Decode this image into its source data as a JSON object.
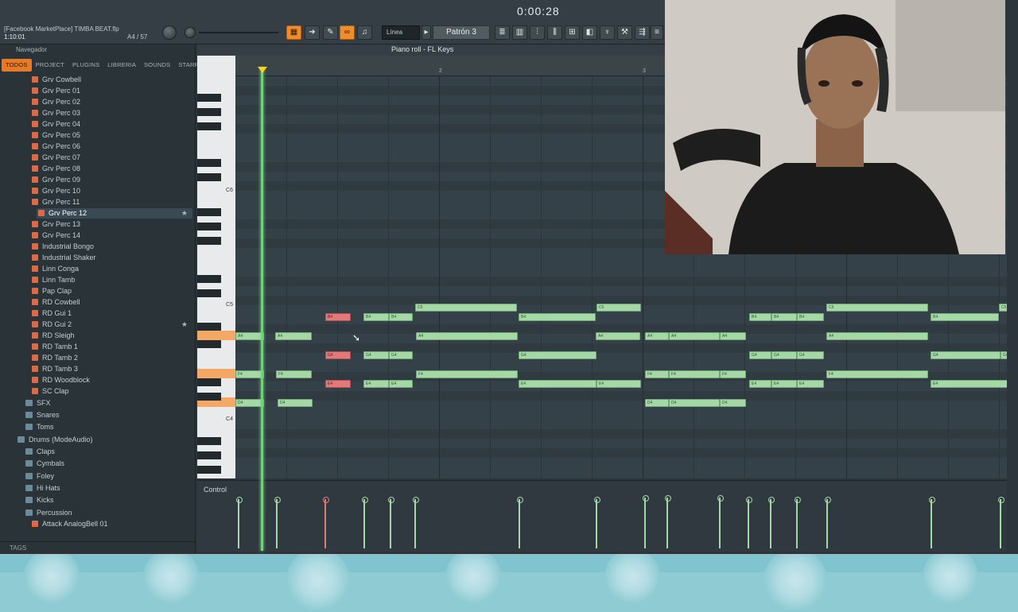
{
  "toolbar": {
    "project_title": "[Facebook MarketPlace] TIMBA BEAT.flp",
    "song_time": "1:10:01",
    "position": "A4 / 57",
    "time_display": "0:00:28",
    "snap_mode": "Línea",
    "pattern": "Patrón 3"
  },
  "browser": {
    "header": "Navegador",
    "tabs": [
      "TODOS",
      "PROJECT",
      "PLUGINS",
      "LIBRERIA",
      "SOUNDS",
      "STARRED"
    ],
    "items": [
      "Grv Cowbell",
      "Grv Perc 01",
      "Grv Perc 02",
      "Grv Perc 03",
      "Grv Perc 04",
      "Grv Perc 05",
      "Grv Perc 06",
      "Grv Perc 07",
      "Grv Perc 08",
      "Grv Perc 09",
      "Grv Perc 10",
      "Grv Perc 11",
      "Grv Perc 12",
      "Grv Perc 13",
      "Grv Perc 14",
      "Industrial Bongo",
      "Industrial Shaker",
      "Linn Conga",
      "Linn Tamb",
      "Pap Clap",
      "RD Cowbell",
      "RD Gui 1",
      "RD Gui 2",
      "RD Sleigh",
      "RD Tamb 1",
      "RD Tamb 2",
      "RD Tamb 3",
      "RD Woodblock",
      "SC Clap"
    ],
    "folders": [
      "SFX",
      "Snares",
      "Toms",
      "Drums (ModeAudio)",
      "Claps",
      "Cymbals",
      "Foley",
      "Hi Hats",
      "Kicks",
      "Percussion",
      "Attack AnalogBell 01"
    ],
    "tags_label": "TAGS"
  },
  "piano_roll": {
    "title": "Piano roll - FL Keys",
    "ruler_marks": [
      "2",
      "3"
    ],
    "key_labels": [
      "C6",
      "C5",
      "C4"
    ],
    "note_labels": {
      "c5": "C5",
      "b4": "B4",
      "a4": "A4",
      "g4": "G4",
      "f4": "F4",
      "e4": "E4",
      "d4": "D4"
    },
    "control_label": "Control"
  },
  "colors": {
    "note": "#a6d7a7",
    "selected_note": "#e07a7a",
    "accent": "#f08c2a",
    "playhead": "#6fd27a"
  }
}
